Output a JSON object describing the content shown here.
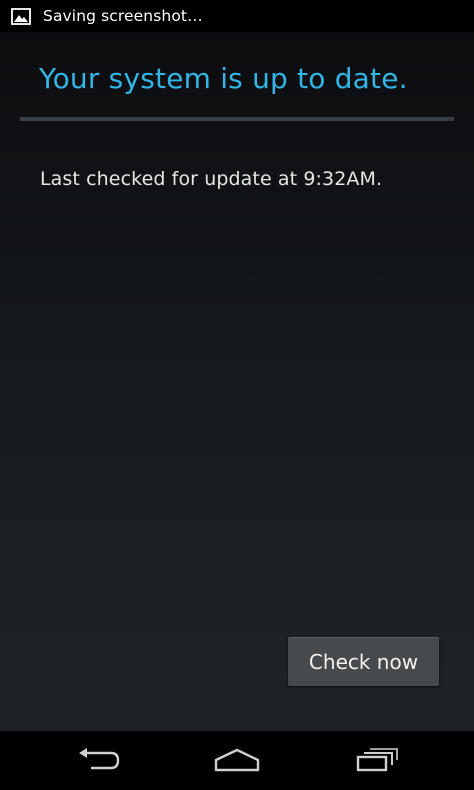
{
  "status_bar": {
    "notification_icon": "image-icon",
    "text": "Saving screenshot…"
  },
  "main": {
    "title": "Your system is up to date.",
    "last_checked": "Last checked for update at 9:32AM."
  },
  "actions": {
    "check_now_label": "Check now"
  },
  "nav_bar": {
    "back_icon": "back-icon",
    "home_icon": "home-icon",
    "recents_icon": "recent-apps-icon"
  },
  "colors": {
    "accent": "#33b5e5",
    "text": "#e6e6e6",
    "button": "#474a4d"
  }
}
